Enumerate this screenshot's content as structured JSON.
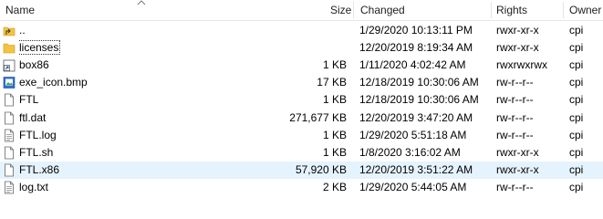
{
  "columns": {
    "name": "Name",
    "size": "Size",
    "changed": "Changed",
    "rights": "Rights",
    "owner": "Owner"
  },
  "rows": [
    {
      "icon": "parent-folder-icon",
      "name": "..",
      "size": "",
      "changed": "1/29/2020 10:13:11 PM",
      "rights": "rwxr-xr-x",
      "owner": "cpi"
    },
    {
      "icon": "folder-icon",
      "name": "licenses",
      "size": "",
      "changed": "12/20/2019 8:19:34 AM",
      "rights": "rwxr-xr-x",
      "owner": "cpi"
    },
    {
      "icon": "shortcut-icon",
      "name": "box86",
      "size": "1 KB",
      "changed": "1/11/2020 4:02:42 AM",
      "rights": "rwxrwxrwx",
      "owner": "cpi"
    },
    {
      "icon": "image-file-icon",
      "name": "exe_icon.bmp",
      "size": "17 KB",
      "changed": "12/18/2019 10:30:06 AM",
      "rights": "rw-r--r--",
      "owner": "cpi"
    },
    {
      "icon": "file-icon",
      "name": "FTL",
      "size": "1 KB",
      "changed": "12/18/2019 10:30:06 AM",
      "rights": "rw-r--r--",
      "owner": "cpi"
    },
    {
      "icon": "file-icon",
      "name": "ftl.dat",
      "size": "271,677 KB",
      "changed": "12/20/2019 3:47:20 AM",
      "rights": "rw-r--r--",
      "owner": "cpi"
    },
    {
      "icon": "text-file-icon",
      "name": "FTL.log",
      "size": "1 KB",
      "changed": "1/29/2020 5:51:18 AM",
      "rights": "rw-r--r--",
      "owner": "cpi"
    },
    {
      "icon": "file-icon",
      "name": "FTL.sh",
      "size": "1 KB",
      "changed": "1/8/2020 3:16:02 AM",
      "rights": "rwxr-xr-x",
      "owner": "cpi"
    },
    {
      "icon": "file-icon",
      "name": "FTL.x86",
      "size": "57,920 KB",
      "changed": "12/20/2019 3:51:22 AM",
      "rights": "rwxr-xr-x",
      "owner": "cpi"
    },
    {
      "icon": "text-file-icon",
      "name": "log.txt",
      "size": "2 KB",
      "changed": "1/29/2020 5:44:05 AM",
      "rights": "rw-r--r--",
      "owner": "cpi"
    }
  ],
  "selected_row": 8,
  "focused_row": 1,
  "colors": {
    "selection": "#e5f3ff",
    "folder": "#f5c342",
    "shortcut_arrow": "#1a5fb4",
    "header_border": "#e5e5e5"
  }
}
